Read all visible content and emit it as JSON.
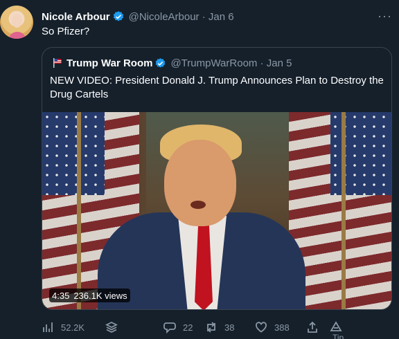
{
  "tweet": {
    "author_name": "Nicole Arbour",
    "author_handle": "@NicoleArbour · Jan 6",
    "text": "So Pfizer?"
  },
  "more_label": "···",
  "quoted": {
    "author_name": "Trump War Room",
    "author_handle": "@TrumpWarRoom · Jan 5",
    "text": "NEW VIDEO: President Donald J. Trump Announces Plan to Destroy the Drug Cartels",
    "video": {
      "duration": "4:35",
      "views": "236.1K views"
    }
  },
  "actions": {
    "views_count": "52.2K",
    "replies_count": "22",
    "retweets_count": "38",
    "likes_count": "388",
    "tip_label": "Tip"
  },
  "colors": {
    "background": "#15202b",
    "verified": "#1d9bf0",
    "muted": "#8b98a5",
    "border": "#38444d"
  }
}
